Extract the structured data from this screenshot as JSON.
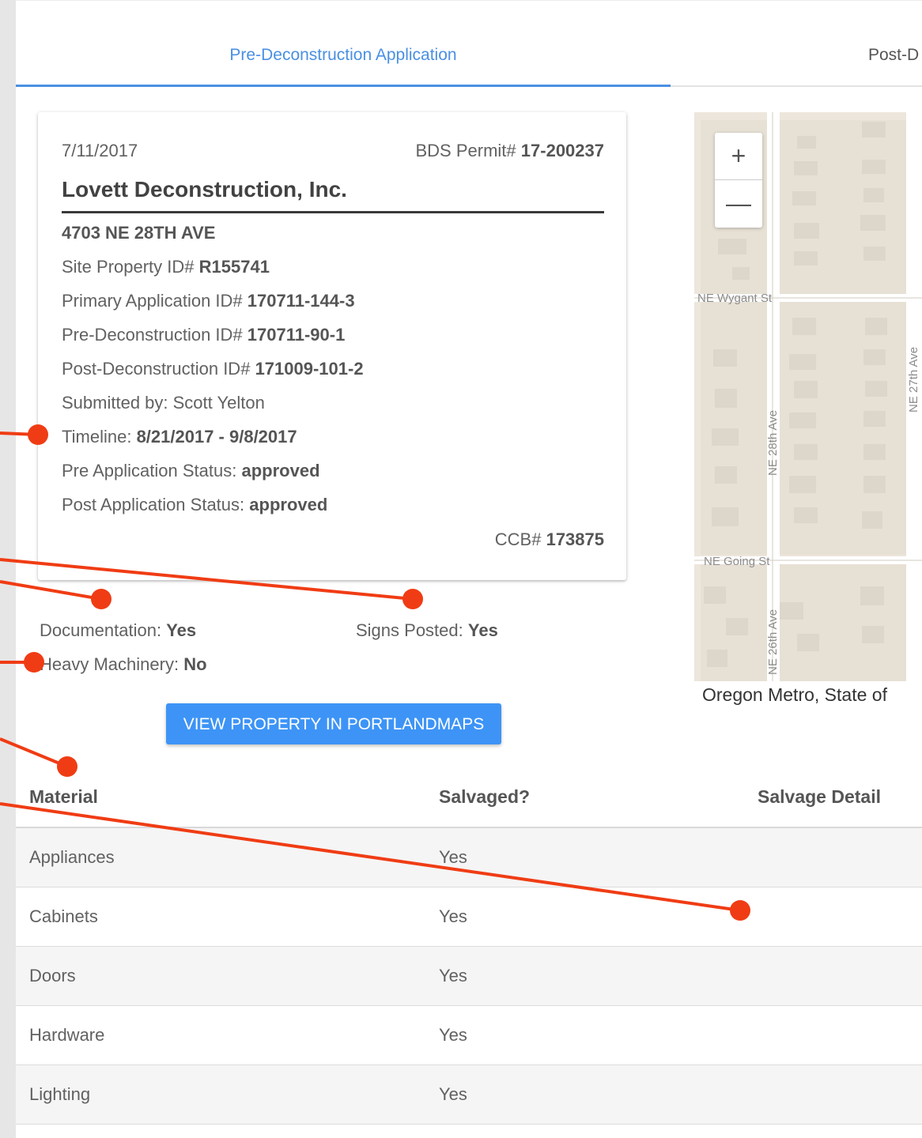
{
  "tabs": [
    {
      "label": "Pre-Deconstruction Application",
      "active": true
    },
    {
      "label": "Post-D",
      "active": false
    }
  ],
  "card": {
    "date": "7/11/2017",
    "permit_label": "BDS Permit#",
    "permit_value": "17-200237",
    "company": "Lovett Deconstruction, Inc.",
    "address": "4703 NE 28TH AVE",
    "site_property_label": "Site Property ID#",
    "site_property_value": "R155741",
    "primary_app_label": "Primary Application ID#",
    "primary_app_value": "170711-144-3",
    "pre_decon_label": "Pre-Deconstruction ID#",
    "pre_decon_value": "170711-90-1",
    "post_decon_label": "Post-Deconstruction ID#",
    "post_decon_value": "171009-101-2",
    "submitted_by": "Submitted by: Scott Yelton",
    "timeline_label": "Timeline:",
    "timeline_value": "8/21/2017 - 9/8/2017",
    "pre_status_label": "Pre Application Status:",
    "pre_status_value": "approved",
    "post_status_label": "Post Application Status:",
    "post_status_value": "approved",
    "ccb_label": "CCB#",
    "ccb_value": "173875"
  },
  "details": {
    "documentation_label": "Documentation:",
    "documentation_value": "Yes",
    "signs_label": "Signs Posted:",
    "signs_value": "Yes",
    "machinery_label": "Heavy Machinery:",
    "machinery_value": "No"
  },
  "button": {
    "label": "VIEW PROPERTY IN PORTLANDMAPS"
  },
  "map": {
    "zoom_in": "+",
    "zoom_out": "—",
    "attribution": "Oregon Metro, State of",
    "streets": {
      "wygant": "NE Wygant St",
      "going": "NE Going St",
      "ave28": "NE 28th Ave",
      "ave27": "NE 27th Ave",
      "ave26": "NE 26th Ave"
    }
  },
  "table": {
    "headers": {
      "material": "Material",
      "salvaged": "Salvaged?",
      "detail": "Salvage Detail"
    },
    "rows": [
      {
        "material": "Appliances",
        "salvaged": "Yes"
      },
      {
        "material": "Cabinets",
        "salvaged": "Yes"
      },
      {
        "material": "Doors",
        "salvaged": "Yes"
      },
      {
        "material": "Hardware",
        "salvaged": "Yes"
      },
      {
        "material": "Lighting",
        "salvaged": "Yes"
      }
    ]
  },
  "colors": {
    "accent": "#4a90e2",
    "button": "#3d94f6",
    "annotation": "#f03c14"
  }
}
